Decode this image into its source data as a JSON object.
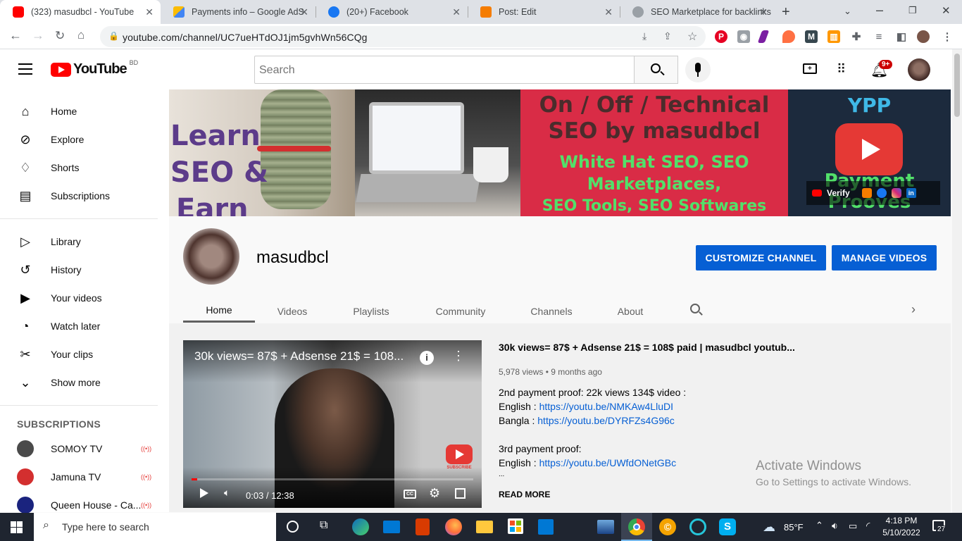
{
  "tabs": [
    {
      "title": "(323) masudbcl - YouTube",
      "color": "#ff0000",
      "active": true
    },
    {
      "title": "Payments info – Google AdSense",
      "color": "#fbbc04",
      "active": false
    },
    {
      "title": "(20+) Facebook",
      "color": "#1877f2",
      "active": false
    },
    {
      "title": "Post: Edit",
      "color": "#f57c00",
      "active": false
    },
    {
      "title": "SEO Marketplace for backlinks",
      "color": "#5f6368",
      "active": false
    }
  ],
  "browser": {
    "url": "youtube.com/channel/UC7ueHTdOJ1jm5gvhWn56CQg"
  },
  "youtube": {
    "logo_text": "YouTube",
    "logo_country": "BD",
    "search_placeholder": "Search",
    "notif_count": "9+"
  },
  "sidebar": {
    "main": [
      {
        "label": "Home",
        "icon": "home-icon"
      },
      {
        "label": "Explore",
        "icon": "explore-icon"
      },
      {
        "label": "Shorts",
        "icon": "shorts-icon"
      },
      {
        "label": "Subscriptions",
        "icon": "subscriptions-icon"
      }
    ],
    "library": [
      {
        "label": "Library",
        "icon": "library-icon"
      },
      {
        "label": "History",
        "icon": "history-icon"
      },
      {
        "label": "Your videos",
        "icon": "your-videos-icon"
      },
      {
        "label": "Watch later",
        "icon": "watch-later-icon"
      },
      {
        "label": "Your clips",
        "icon": "clips-icon"
      },
      {
        "label": "Show more",
        "icon": "chevron-down-icon"
      }
    ],
    "subscriptions_heading": "SUBSCRIPTIONS",
    "subscriptions": [
      {
        "label": "SOMOY TV",
        "color": "#4a4a4a"
      },
      {
        "label": "Jamuna TV",
        "color": "#d32f2f"
      },
      {
        "label": "Queen House - Ca...",
        "color": "#1a237e"
      }
    ]
  },
  "banner": {
    "left_text": [
      "Learn",
      "SEO &",
      "Earn"
    ],
    "headline1": "On / Off / Technical",
    "headline2": "SEO by masudbcl",
    "sub1": "White Hat SEO, SEO",
    "sub2": "Marketplaces,",
    "sub3": "SEO Tools, SEO Softwares",
    "right_top": "YPP",
    "right_bottom1": "Payment",
    "right_bottom2": "Prooves",
    "links_label": "Verify"
  },
  "channel": {
    "name": "masudbcl",
    "customize_label": "CUSTOMIZE CHANNEL",
    "manage_label": "MANAGE VIDEOS",
    "tabs": [
      "Home",
      "Videos",
      "Playlists",
      "Community",
      "Channels",
      "About"
    ]
  },
  "video": {
    "overlay_title": "30k views= 87$ + Adsense 21$ = 108...",
    "title": "30k views= 87$ + Adsense 21$ = 108$ paid | masudbcl youtub...",
    "meta": "5,978 views • 9 months ago",
    "time": "0:03 / 12:38",
    "subscribe_label": "SUBSCRIBE",
    "progress": 0.004,
    "desc": [
      {
        "text": "2nd payment proof: 22k views 134$ video :",
        "link": ""
      },
      {
        "text": "English : ",
        "link": "https://youtu.be/NMKAw4LluDI"
      },
      {
        "text": "Bangla : ",
        "link": "https://youtu.be/DYRFZs4G96c"
      },
      {
        "text": "",
        "link": ""
      },
      {
        "text": "3rd payment proof:",
        "link": ""
      },
      {
        "text": "English : ",
        "link": "https://youtu.be/UWfdONetGBc"
      },
      {
        "text": "...",
        "link": ""
      }
    ],
    "read_more": "READ MORE"
  },
  "watermark": {
    "line1": "Activate Windows",
    "line2": "Go to Settings to activate Windows."
  },
  "taskbar": {
    "search_placeholder": "Type here to search",
    "weather": "85°F",
    "time": "4:18 PM",
    "date": "5/10/2022",
    "notif_count": "27"
  }
}
